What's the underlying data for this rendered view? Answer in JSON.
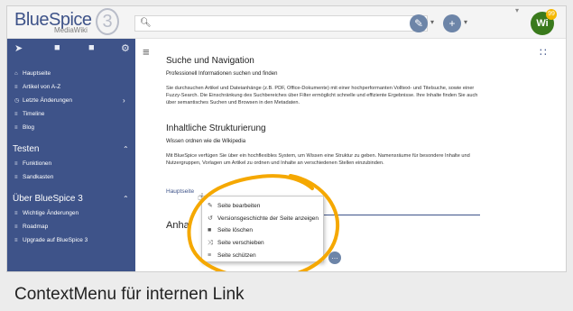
{
  "logo": {
    "name": "BlueSpice",
    "sub": "MediaWiki",
    "version": "3"
  },
  "search": {
    "placeholder": ""
  },
  "topbar": {
    "avatar_initials": "Wi",
    "avatar_badge": "99"
  },
  "sidebar": {
    "items_main": [
      {
        "label": "Hauptseite",
        "icon": "home-icon"
      },
      {
        "label": "Artikel von A-Z",
        "icon": "list-icon"
      },
      {
        "label": "Letzte Änderungen",
        "icon": "clock-icon"
      },
      {
        "label": "Timeline",
        "icon": "list-icon"
      },
      {
        "label": "Blog",
        "icon": "list-icon"
      }
    ],
    "section_testen": "Testen",
    "items_testen": [
      {
        "label": "Funktionen"
      },
      {
        "label": "Sandkasten"
      }
    ],
    "section_ueber": "Über BlueSpice 3",
    "items_ueber": [
      {
        "label": "Wichtige Änderungen"
      },
      {
        "label": "Roadmap"
      },
      {
        "label": "Upgrade auf BlueSpice 3"
      }
    ]
  },
  "content": {
    "h_suche": "Suche und Navigation",
    "sub_suche": "Professionell Informationen suchen und finden",
    "para_suche": "Sie durchsuchen Artikel und Dateianhänge (z.B. PDF, Office-Dokumente) mit einer hochperformanten Volltext- und Titelsuche, sowie einer Fuzzy-Search. Die Einschränkung des Suchbereiches über Filter ermöglicht schnelle und effiziente Ergebnisse. Ihre Inhalte finden Sie auch über semantisches Suchen und Browsen in den Metadaten.",
    "h_struktur": "Inhaltliche Strukturierung",
    "sub_struktur": "Wissen ordnen wie die Wikipedia",
    "para_struktur": "Mit BlueSpice verfügen Sie über ein hochflexibles System, um Wissen eine Struktur zu geben. Namensräume für besondere Inhalte und Nutzergruppen, Vorlagen um Artikel zu ordnen und Inhalte an verschiedenen Stellen einzubinden.",
    "link": "Hauptseite",
    "h_anhang": "Anha"
  },
  "context_menu": [
    {
      "label": "Seite bearbeiten",
      "icon": "pencil-icon"
    },
    {
      "label": "Versionsgeschichte der Seite anzeigen",
      "icon": "history-icon"
    },
    {
      "label": "Seite löschen",
      "icon": "trash-icon"
    },
    {
      "label": "Seite verschieben",
      "icon": "move-icon"
    },
    {
      "label": "Seite schützen",
      "icon": "lock-icon"
    }
  ],
  "caption": "ContextMenu für internen Link",
  "colors": {
    "sidebar": "#3e5389",
    "highlight": "#f5a800"
  }
}
